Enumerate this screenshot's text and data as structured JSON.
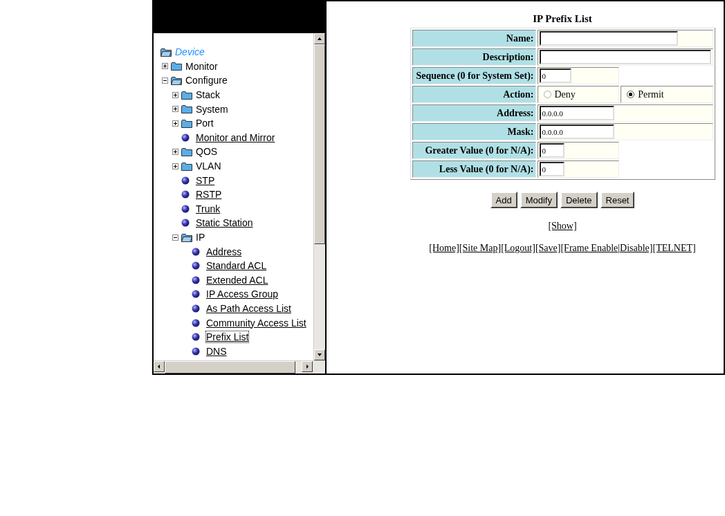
{
  "tree": {
    "label": "Device",
    "kind": "root",
    "expanded": true,
    "children": [
      {
        "label": "Monitor",
        "kind": "folder",
        "expanded": false
      },
      {
        "label": "Configure",
        "kind": "folder",
        "expanded": true,
        "children": [
          {
            "label": "Stack",
            "kind": "folder",
            "expanded": false
          },
          {
            "label": "System",
            "kind": "folder",
            "expanded": false
          },
          {
            "label": "Port",
            "kind": "folder",
            "expanded": false
          },
          {
            "label": "Monitor and Mirror",
            "kind": "leaf",
            "selected": false
          },
          {
            "label": "QOS",
            "kind": "folder",
            "expanded": false
          },
          {
            "label": "VLAN",
            "kind": "folder",
            "expanded": false
          },
          {
            "label": "STP",
            "kind": "leaf",
            "selected": false
          },
          {
            "label": "RSTP",
            "kind": "leaf",
            "selected": false
          },
          {
            "label": "Trunk",
            "kind": "leaf",
            "selected": false
          },
          {
            "label": "Static Station",
            "kind": "leaf",
            "selected": false
          },
          {
            "label": "IP",
            "kind": "folder",
            "expanded": true,
            "children": [
              {
                "label": "Address",
                "kind": "leaf",
                "selected": false
              },
              {
                "label": "Standard ACL",
                "kind": "leaf",
                "selected": false
              },
              {
                "label": "Extended ACL",
                "kind": "leaf",
                "selected": false
              },
              {
                "label": "IP Access Group",
                "kind": "leaf",
                "selected": false
              },
              {
                "label": "As Path Access List",
                "kind": "leaf",
                "selected": false
              },
              {
                "label": "Community Access List",
                "kind": "leaf",
                "selected": false
              },
              {
                "label": "Prefix List",
                "kind": "leaf",
                "selected": true
              },
              {
                "label": "DNS",
                "kind": "leaf",
                "selected": false
              }
            ]
          }
        ]
      }
    ]
  },
  "form": {
    "title": "IP Prefix List",
    "rows": [
      {
        "label": "Name:",
        "kind": "text",
        "value": ""
      },
      {
        "label": "Description:",
        "kind": "text",
        "value": ""
      },
      {
        "label": "Sequence (0 for System Set):",
        "kind": "text",
        "value": "0"
      },
      {
        "label": "Action:",
        "kind": "radio",
        "options": [
          {
            "label": "Deny",
            "selected": false
          },
          {
            "label": "Permit",
            "selected": true
          }
        ]
      },
      {
        "label": "Address:",
        "kind": "text",
        "value": "0.0.0.0"
      },
      {
        "label": "Mask:",
        "kind": "text",
        "value": "0.0.0.0"
      },
      {
        "label": "Greater Value (0 for N/A):",
        "kind": "text",
        "value": "0"
      },
      {
        "label": "Less Value (0 for N/A):",
        "kind": "text",
        "value": "0"
      }
    ],
    "buttons": [
      "Add",
      "Modify",
      "Delete",
      "Reset"
    ]
  },
  "show_link": "[Show]",
  "footer_links": [
    "[Home]",
    "[Site Map]",
    "[Logout]",
    "[Save]",
    "[Frame Enable",
    "|Disable]",
    "[TELNET]"
  ]
}
